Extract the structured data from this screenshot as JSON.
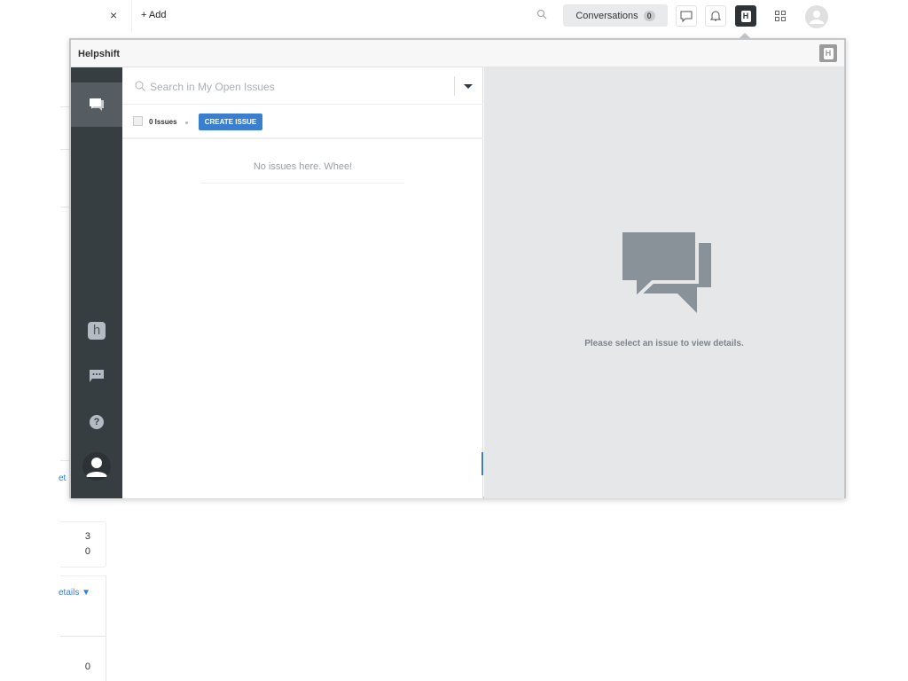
{
  "topbar": {
    "close_label": "×",
    "add_label": "+ Add",
    "conversations_label": "Conversations",
    "conversations_count": "0"
  },
  "background": {
    "link1": "et",
    "value1": "3",
    "value2": "0",
    "details_link": "etails ▼",
    "value3": "0"
  },
  "popup": {
    "title": "Helpshift",
    "search_placeholder": "Search in My Open Issues",
    "issues_count": "0 Issues",
    "create_issue_label": "CREATE ISSUE",
    "empty_message": "No issues here. Whee!",
    "detail_message": "Please select an issue to view details.",
    "sidebar": [
      {
        "icon": "chat-bubbles-icon",
        "active": true
      },
      {
        "icon": "helpshift-h-icon"
      },
      {
        "icon": "message-dots-icon"
      },
      {
        "icon": "help-icon"
      },
      {
        "icon": "user-avatar-icon"
      }
    ]
  },
  "colors": {
    "sidebar": "#373e42",
    "sidebar_active": "#555d63",
    "accent": "#3a7ecf",
    "detail_bg": "#e6e7e9"
  }
}
